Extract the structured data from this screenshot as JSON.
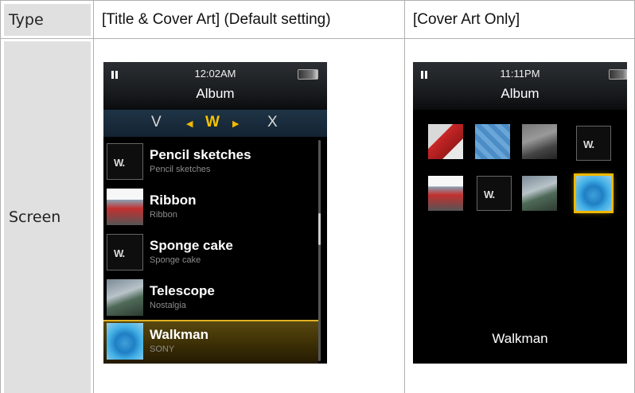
{
  "table": {
    "header_type": "Type",
    "header_col1": "[Title & Cover Art] (Default setting)",
    "header_col2": "[Cover Art Only]",
    "row_label": "Screen"
  },
  "screen1": {
    "time": "12:02AM",
    "title": "Album",
    "letters": {
      "prev": "V",
      "current": "W",
      "next": "X"
    },
    "items": [
      {
        "title": "Pencil sketches",
        "subtitle": "Pencil sketches",
        "art": "walkman-logo-icon"
      },
      {
        "title": "Ribbon",
        "subtitle": "Ribbon",
        "art": "ribbon-art"
      },
      {
        "title": "Sponge cake",
        "subtitle": "Sponge cake",
        "art": "walkman-logo-icon"
      },
      {
        "title": "Telescope",
        "subtitle": "Nostalgia",
        "art": "bird-art"
      },
      {
        "title": "Walkman",
        "subtitle": "SONY",
        "art": "blue-art",
        "selected": true
      }
    ],
    "walkman_logo": "W."
  },
  "screen2": {
    "time": "11:11PM",
    "title": "Album",
    "selected_album": "Walkman",
    "walkman_logo": "W."
  },
  "colors": {
    "accent": "#f0b800",
    "header_bg": "#e0e0e0"
  }
}
